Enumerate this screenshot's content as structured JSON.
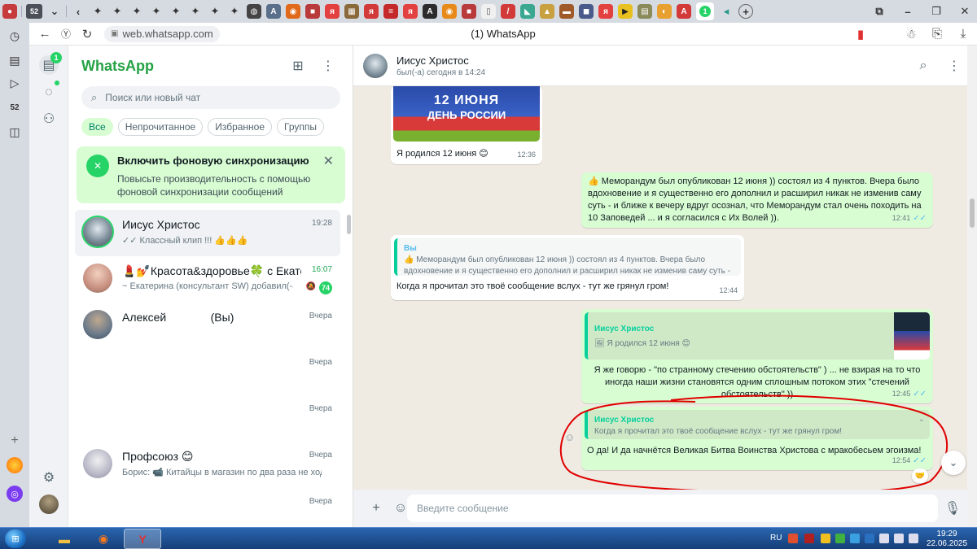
{
  "browser": {
    "tab_count": "52",
    "url": "web.whatsapp.com",
    "page_title": "(1) WhatsApp"
  },
  "rail": {
    "chats_badge": "1"
  },
  "chatlist": {
    "app_title": "WhatsApp",
    "search_placeholder": "Поиск или новый чат",
    "filters": [
      "Все",
      "Непрочитанное",
      "Избранное",
      "Группы"
    ],
    "sync_banner": {
      "title": "Включить фоновую синхронизацию",
      "text": "Повысьте производительность с помощью фоновой синхронизации сообщений"
    },
    "chats": [
      {
        "name": "Иисус Христос",
        "time": "19:28",
        "preview": "✓✓ Классный клип !!! 👍👍👍"
      },
      {
        "name": "💄💅Красота&здоровье🍀 с Екатери...",
        "time": "16:07",
        "preview": "~ Екатерина (консультант SW) добавил(-а) ...",
        "unread": "74"
      },
      {
        "name": "Алексей              (Вы)",
        "time": "Вчера",
        "preview": ""
      },
      {
        "name": "",
        "time": "Вчера",
        "preview": ""
      },
      {
        "name": "",
        "time": "Вчера",
        "preview": ""
      },
      {
        "name": "Профсоюз 😊",
        "time": "Вчера",
        "preview": "Борис: 📹 Китайцы в магазин по два раза не ходя..."
      },
      {
        "name": "",
        "time": "Вчера",
        "preview": ""
      }
    ]
  },
  "conversation": {
    "contact_name": "Иисус Христос",
    "contact_status": "был(-а) сегодня в 14:24",
    "image_caption_banner": "12 ИЮНЯ",
    "image_caption_banner2": "ДЕНЬ РОССИИ",
    "messages": [
      {
        "text": "Я родился 12 июня 😊",
        "time": "12:36"
      },
      {
        "text": "👍 Меморандум был опубликован 12 июня )) состоял из 4 пунктов. Вчера было вдохновение и я существенно его дополнил и расширил никак не изменив саму суть - и ближе к вечеру вдруг осознал, что Меморандум стал очень походить на 10 Заповедей ... и я согласился с Их Волей )).",
        "time": "12:41"
      },
      {
        "quote_name": "Вы",
        "quote_text": "👍 Меморандум был опубликован 12 июня )) состоял из 4 пунктов. Вчера было вдохновение и я существенно его дополнил и расширил никак не изменив саму суть - и...",
        "text": "Когда я прочитал это твоё сообщение вслух - тут же грянул гром!",
        "time": "12:44"
      },
      {
        "quote_name": "Иисус Христос",
        "quote_text": "🖼 Я родился 12 июня 😊",
        "text": "Я же говорю - \"по странному стечению обстоятельств\" ) ... не взирая на то что иногда наши жизни становятся одним сплошным потоком этих \"стечений обстоятельств\" ))",
        "time": "12:45"
      },
      {
        "quote_name": "Иисус Христос",
        "quote_text": "Когда я прочитал это твоё сообщение вслух - тут же грянул гром!",
        "text": "О да! И да начнётся Великая Битва Воинства Христова с мракобесьем эгоизма!",
        "time": "12:54",
        "reaction": "🤝"
      }
    ],
    "composer_placeholder": "Введите сообщение"
  },
  "taskbar": {
    "lang": "RU",
    "time": "19:29",
    "date": "22.06.2025"
  },
  "colors": {
    "wa_green": "#25d366",
    "outgoing_bubble": "#d9fdd3",
    "annotation_red": "#e00000"
  }
}
